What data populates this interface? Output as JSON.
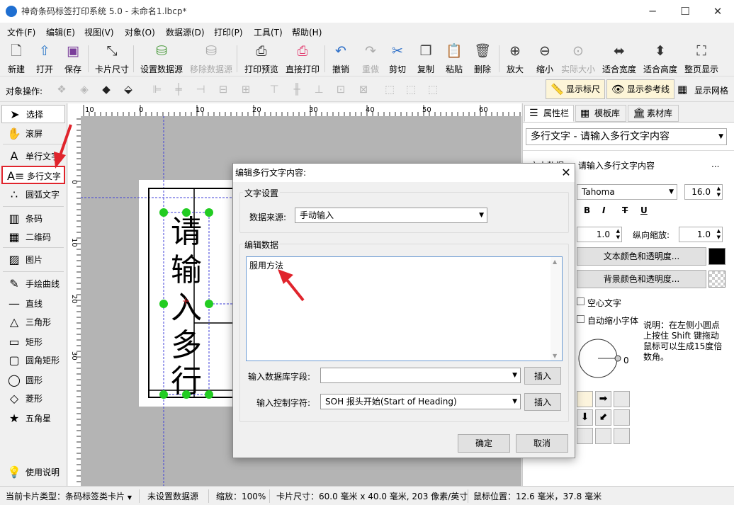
{
  "window": {
    "title": "神奇条码标签打印系统 5.0 - 未命名1.lbcp*",
    "controls": [
      "─",
      "☐",
      "✕"
    ]
  },
  "menu": [
    "文件(F)",
    "编辑(E)",
    "视图(V)",
    "对象(O)",
    "数据源(D)",
    "打印(P)",
    "工具(T)",
    "帮助(H)"
  ],
  "toolbar": [
    {
      "label": "新建",
      "icon": "new-file-icon",
      "glyph": "🗋",
      "color": "#444",
      "disabled": false
    },
    {
      "label": "打开",
      "icon": "open-icon",
      "glyph": "⇧",
      "color": "#2d78c8",
      "disabled": false
    },
    {
      "label": "保存",
      "icon": "save-icon",
      "glyph": "▣",
      "color": "#7a3d9a",
      "disabled": false
    },
    {
      "label": "卡片尺寸",
      "icon": "card-size-icon",
      "glyph": "⤡",
      "color": "#333",
      "disabled": false
    },
    {
      "label": "设置数据源",
      "icon": "database-icon",
      "glyph": "⛁",
      "color": "#4a9a3c",
      "disabled": false
    },
    {
      "label": "移除数据源",
      "icon": "remove-database-icon",
      "glyph": "⛁",
      "color": "#aaa",
      "disabled": true
    },
    {
      "label": "打印预览",
      "icon": "print-preview-icon",
      "glyph": "⎙",
      "color": "#333",
      "disabled": false
    },
    {
      "label": "直接打印",
      "icon": "print-icon",
      "glyph": "⎙",
      "color": "#e23a6e",
      "disabled": false
    },
    {
      "label": "撤销",
      "icon": "undo-icon",
      "glyph": "↶",
      "color": "#2d6fc8",
      "disabled": false
    },
    {
      "label": "重做",
      "icon": "redo-icon",
      "glyph": "↷",
      "color": "#aaa",
      "disabled": true
    },
    {
      "label": "剪切",
      "icon": "cut-icon",
      "glyph": "✂",
      "color": "#2d6fc8",
      "disabled": false
    },
    {
      "label": "复制",
      "icon": "copy-icon",
      "glyph": "❐",
      "color": "#444",
      "disabled": false
    },
    {
      "label": "粘贴",
      "icon": "paste-icon",
      "glyph": "📋",
      "color": "#c98a2c",
      "disabled": false
    },
    {
      "label": "删除",
      "icon": "delete-icon",
      "glyph": "🗑",
      "color": "#444",
      "disabled": false
    },
    {
      "label": "放大",
      "icon": "zoom-in-icon",
      "glyph": "⊕",
      "color": "#333",
      "disabled": false
    },
    {
      "label": "缩小",
      "icon": "zoom-out-icon",
      "glyph": "⊖",
      "color": "#333",
      "disabled": false
    },
    {
      "label": "实际大小",
      "icon": "actual-size-icon",
      "glyph": "⊙",
      "color": "#aaa",
      "disabled": true
    },
    {
      "label": "适合宽度",
      "icon": "fit-width-icon",
      "glyph": "⬌",
      "color": "#333",
      "disabled": false
    },
    {
      "label": "适合高度",
      "icon": "fit-height-icon",
      "glyph": "⬍",
      "color": "#333",
      "disabled": false
    },
    {
      "label": "整页显示",
      "icon": "fit-page-icon",
      "glyph": "⛶",
      "color": "#333",
      "disabled": false
    }
  ],
  "objectbar": {
    "label": "对象操作:",
    "show_ruler": "显示标尺",
    "show_guides": "显示参考线",
    "show_grid": "显示网格"
  },
  "tools": [
    {
      "label": "选择",
      "icon": "pointer-icon",
      "glyph": "➤",
      "state": "selected"
    },
    {
      "label": "滚屏",
      "icon": "hand-icon",
      "glyph": "✋",
      "state": ""
    },
    {
      "label": "单行文字",
      "icon": "single-line-text-icon",
      "glyph": "A",
      "state": ""
    },
    {
      "label": "多行文字",
      "icon": "multi-line-text-icon",
      "glyph": "A≡",
      "state": "highlighted"
    },
    {
      "label": "圆弧文字",
      "icon": "arc-text-icon",
      "glyph": "∴",
      "state": ""
    },
    {
      "label": "条码",
      "icon": "barcode-icon",
      "glyph": "▥",
      "state": ""
    },
    {
      "label": "二维码",
      "icon": "qrcode-icon",
      "glyph": "▦",
      "state": ""
    },
    {
      "label": "图片",
      "icon": "image-icon",
      "glyph": "▨",
      "state": ""
    },
    {
      "label": "手绘曲线",
      "icon": "freehand-icon",
      "glyph": "✎",
      "state": ""
    },
    {
      "label": "直线",
      "icon": "line-icon",
      "glyph": "—",
      "state": ""
    },
    {
      "label": "三角形",
      "icon": "triangle-icon",
      "glyph": "△",
      "state": ""
    },
    {
      "label": "矩形",
      "icon": "rectangle-icon",
      "glyph": "▭",
      "state": ""
    },
    {
      "label": "圆角矩形",
      "icon": "rounded-rect-icon",
      "glyph": "▢",
      "state": ""
    },
    {
      "label": "圆形",
      "icon": "circle-icon",
      "glyph": "◯",
      "state": ""
    },
    {
      "label": "菱形",
      "icon": "diamond-icon",
      "glyph": "◇",
      "state": ""
    },
    {
      "label": "五角星",
      "icon": "star-icon",
      "glyph": "★",
      "state": ""
    }
  ],
  "help": {
    "label": "使用说明",
    "icon": "bulb-icon"
  },
  "ruler": {
    "h_labels": [
      "10",
      "0",
      "10",
      "20",
      "30",
      "40",
      "50",
      "60"
    ],
    "v_labels": [
      "0",
      "10",
      "20",
      "30"
    ]
  },
  "label_text": [
    "请",
    "输",
    "入",
    "多",
    "行"
  ],
  "rightpanel": {
    "tabs": [
      "属性栏",
      "模板库",
      "素材库"
    ],
    "object_select": "多行文字 - 请输入多行文字内容",
    "data_label": "文本数据",
    "data_value": "请输入多行文字内容",
    "data_more": "...",
    "font": "Tahoma",
    "font_size": "16.0",
    "style_buttons": [
      "B",
      "I",
      "T",
      "U"
    ],
    "hscale": "1.0",
    "vscale_label": "纵向缩放:",
    "vscale": "1.0",
    "text_color_btn": "文本颜色和透明度...",
    "bg_color_btn": "背景颜色和透明度...",
    "text_color": "#000000",
    "hollow": "空心文字",
    "autoshrink": "自动缩小字体",
    "rotation_value": "0",
    "help_text": [
      "说明：在左侧小圆点",
      "上按住 Shift 键拖动",
      "鼠标可以生成15度倍",
      "数角。"
    ],
    "align_glyphs": [
      "",
      "➡",
      "",
      "⬇",
      "⬋",
      ""
    ]
  },
  "status": {
    "card_type_label": "当前卡片类型：",
    "card_type": "条码标签类卡片",
    "datasource": "未设置数据源",
    "zoom": "缩放：100%",
    "card_size": "卡片尺寸：60.0 毫米 x 40.0 毫米, 203 像素/英寸",
    "mouse": "鼠标位置：12.6 毫米，37.8 毫米"
  },
  "dialog": {
    "title": "编辑多行文字内容:",
    "close": "✕",
    "text_settings_label": "文字设置",
    "data_source_label": "数据来源:",
    "data_source_value": "手动输入",
    "edit_data_label": "编辑数据",
    "text_value": "服用方法",
    "db_field_label": "输入数据库字段:",
    "db_field_value": "",
    "insert": "插入",
    "ctrl_char_label": "输入控制字符:",
    "ctrl_char_value": "SOH  报头开始(Start of Heading)",
    "ok": "确定",
    "cancel": "取消"
  }
}
